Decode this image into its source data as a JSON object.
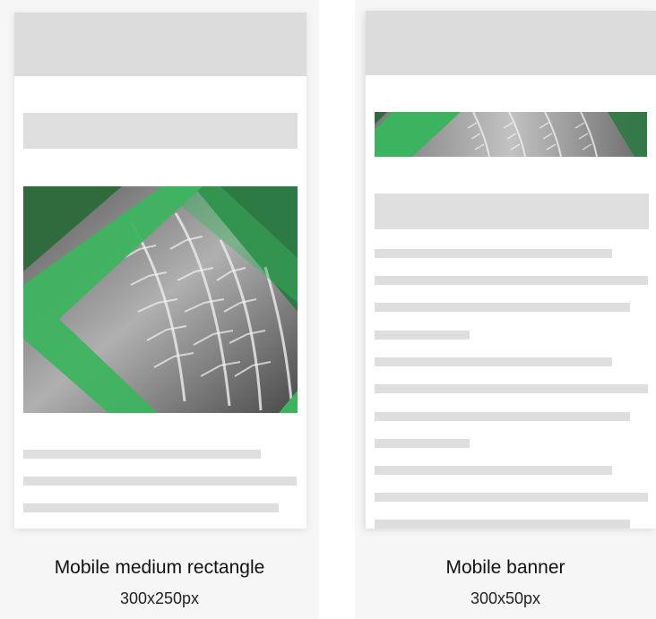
{
  "colors": {
    "accent_green": "#3cb45f",
    "placeholder_gray": "#dedede",
    "header_gray": "#dcdcdc"
  },
  "previews": [
    {
      "title": "Mobile medium rectangle",
      "size": "300x250px"
    },
    {
      "title": "Mobile banner",
      "size": "300x50px"
    }
  ]
}
